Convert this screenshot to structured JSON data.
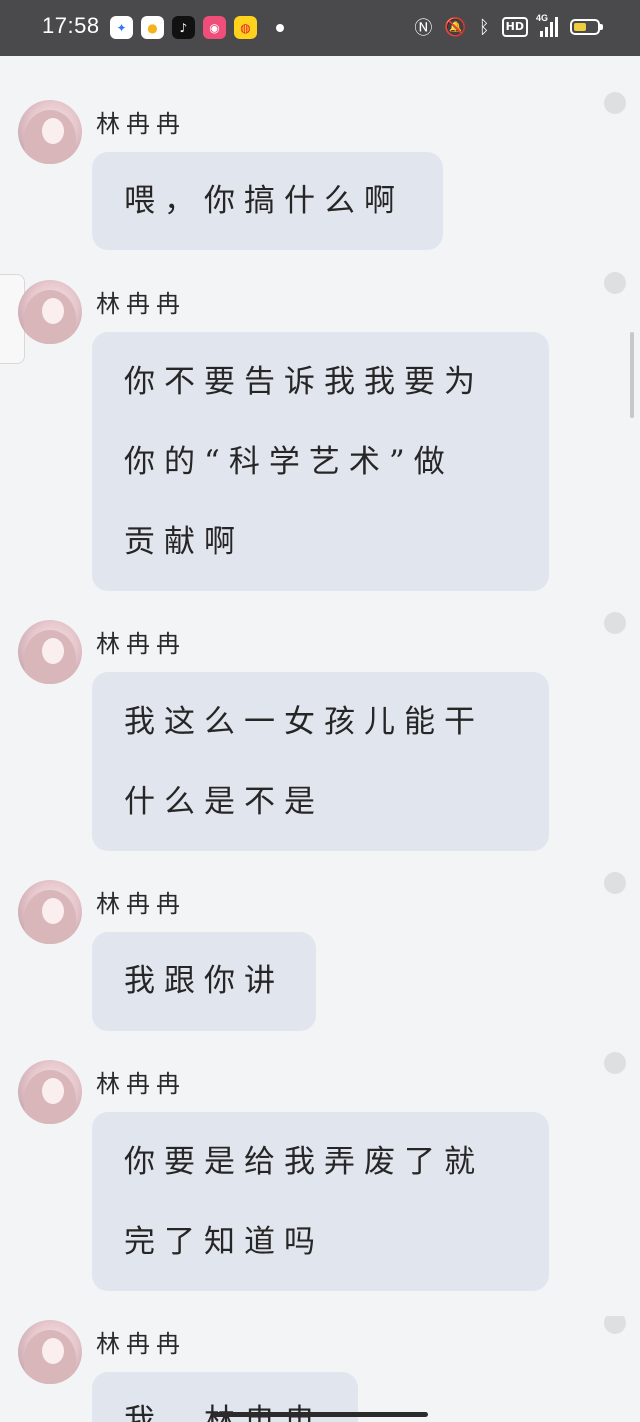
{
  "status_bar": {
    "time": "17:58",
    "app_icons": [
      "baidu-map-icon",
      "bulb-app-icon",
      "tiktok-icon",
      "pink-app-icon",
      "weibo-icon"
    ],
    "network_label": "4G",
    "hd_label": "HD",
    "battery_level": 0.55,
    "battery_color": "#f0cd3c"
  },
  "messages": [
    {
      "sender": "林冉冉",
      "text": "喂，你搞什么啊"
    },
    {
      "sender": "林冉冉",
      "text": "你不要告诉我我要为\n你的“科学艺术”做\n贡献啊"
    },
    {
      "sender": "林冉冉",
      "text": "我这么一女孩儿能干\n什么是不是"
    },
    {
      "sender": "林冉冉",
      "text": "我跟你讲"
    },
    {
      "sender": "林冉冉",
      "text": "你要是给我弄废了就\n完了知道吗"
    },
    {
      "sender": "林冉冉",
      "text": "我，林冉冉"
    }
  ],
  "colors": {
    "status_bar_bg": "#4a4a4c",
    "page_bg": "#f3f4f6",
    "bubble_bg": "#e1e6ee"
  }
}
